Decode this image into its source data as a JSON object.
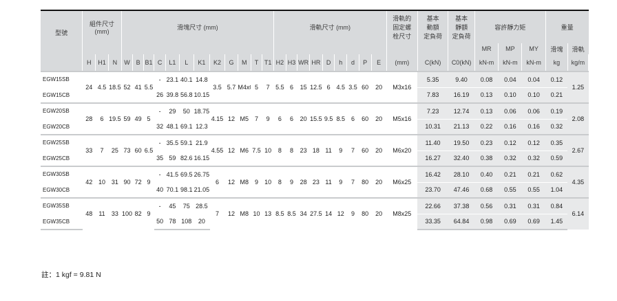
{
  "header": {
    "model": "型號",
    "assembly": "組件尺寸\n(mm)",
    "block": "滑塊尺寸 (mm)",
    "rail": "滑軌尺寸 (mm)",
    "bolt": "滑軌的\n固定螺\n栓尺寸",
    "basic_dynamic": "基本\n動額\n定負荷",
    "basic_static": "基本\n靜額\n定負荷",
    "static_moment": "容許靜力矩",
    "weight": "重量",
    "mr": "MR",
    "mp": "MP",
    "my": "MY",
    "block_w": "滑塊",
    "rail_w": "滑軌",
    "cols": [
      "H",
      "H1",
      "N",
      "W",
      "B",
      "B1",
      "C",
      "L1",
      "L",
      "K1",
      "K2",
      "G",
      "M",
      "T",
      "T1",
      "H2",
      "H3",
      "WR",
      "HR",
      "D",
      "h",
      "d",
      "P",
      "E"
    ],
    "bolt_unit": "(mm)",
    "c_unit": "C(kN)",
    "c0_unit": "C0(kN)",
    "knm1": "kN-m",
    "knm2": "kN-m",
    "knm3": "kN-m",
    "kg": "kg",
    "kgm": "kg/m"
  },
  "groups": [
    {
      "models": [
        "EGW15SB",
        "EGW15CB"
      ],
      "H": "24",
      "H1": "4.5",
      "N": "18.5",
      "W": "52",
      "B": "41",
      "B1": "5.5",
      "rows": [
        {
          "C": "-",
          "L1": "23.1",
          "L": "40.1",
          "K1": "14.8",
          "C_kN": "5.35",
          "C0_kN": "9.40",
          "MR": "0.08",
          "MP": "0.04",
          "MY": "0.04",
          "kg": "0.12"
        },
        {
          "C": "26",
          "L1": "39.8",
          "L": "56.8",
          "K1": "10.15",
          "C_kN": "7.83",
          "C0_kN": "16.19",
          "MR": "0.13",
          "MP": "0.10",
          "MY": "0.10",
          "kg": "0.21"
        }
      ],
      "K2": "3.5",
      "G": "5.7",
      "M": "M4x0.7",
      "T": "5",
      "T1": "7",
      "H2": "5.5",
      "H3": "6",
      "WR": "15",
      "HR": "12.5",
      "D": "6",
      "h": "4.5",
      "d": "3.5",
      "P": "60",
      "E": "20",
      "bolt": "M3x16",
      "rail_kgm": "1.25"
    },
    {
      "models": [
        "EGW20SB",
        "EGW20CB"
      ],
      "H": "28",
      "H1": "6",
      "N": "19.5",
      "W": "59",
      "B": "49",
      "B1": "5",
      "rows": [
        {
          "C": "-",
          "L1": "29",
          "L": "50",
          "K1": "18.75",
          "C_kN": "7.23",
          "C0_kN": "12.74",
          "MR": "0.13",
          "MP": "0.06",
          "MY": "0.06",
          "kg": "0.19"
        },
        {
          "C": "32",
          "L1": "48.1",
          "L": "69.1",
          "K1": "12.3",
          "C_kN": "10.31",
          "C0_kN": "21.13",
          "MR": "0.22",
          "MP": "0.16",
          "MY": "0.16",
          "kg": "0.32"
        }
      ],
      "K2": "4.15",
      "G": "12",
      "M": "M5",
      "T": "7",
      "T1": "9",
      "H2": "6",
      "H3": "6",
      "WR": "20",
      "HR": "15.5",
      "D": "9.5",
      "h": "8.5",
      "d": "6",
      "P": "60",
      "E": "20",
      "bolt": "M5x16",
      "rail_kgm": "2.08"
    },
    {
      "models": [
        "EGW25SB",
        "EGW25CB"
      ],
      "H": "33",
      "H1": "7",
      "N": "25",
      "W": "73",
      "B": "60",
      "B1": "6.5",
      "rows": [
        {
          "C": "-",
          "L1": "35.5",
          "L": "59.1",
          "K1": "21.9",
          "C_kN": "11.40",
          "C0_kN": "19.50",
          "MR": "0.23",
          "MP": "0.12",
          "MY": "0.12",
          "kg": "0.35"
        },
        {
          "C": "35",
          "L1": "59",
          "L": "82.6",
          "K1": "16.15",
          "C_kN": "16.27",
          "C0_kN": "32.40",
          "MR": "0.38",
          "MP": "0.32",
          "MY": "0.32",
          "kg": "0.59"
        }
      ],
      "K2": "4.55",
      "G": "12",
      "M": "M6",
      "T": "7.5",
      "T1": "10",
      "H2": "8",
      "H3": "8",
      "WR": "23",
      "HR": "18",
      "D": "11",
      "h": "9",
      "d": "7",
      "P": "60",
      "E": "20",
      "bolt": "M6x20",
      "rail_kgm": "2.67"
    },
    {
      "models": [
        "EGW30SB",
        "EGW30CB"
      ],
      "H": "42",
      "H1": "10",
      "N": "31",
      "W": "90",
      "B": "72",
      "B1": "9",
      "rows": [
        {
          "C": "-",
          "L1": "41.5",
          "L": "69.5",
          "K1": "26.75",
          "C_kN": "16.42",
          "C0_kN": "28.10",
          "MR": "0.40",
          "MP": "0.21",
          "MY": "0.21",
          "kg": "0.62"
        },
        {
          "C": "40",
          "L1": "70.1",
          "L": "98.1",
          "K1": "21.05",
          "C_kN": "23.70",
          "C0_kN": "47.46",
          "MR": "0.68",
          "MP": "0.55",
          "MY": "0.55",
          "kg": "1.04"
        }
      ],
      "K2": "6",
      "G": "12",
      "M": "M8",
      "T": "9",
      "T1": "10",
      "H2": "8",
      "H3": "9",
      "WR": "28",
      "HR": "23",
      "D": "11",
      "h": "9",
      "d": "7",
      "P": "80",
      "E": "20",
      "bolt": "M6x25",
      "rail_kgm": "4.35"
    },
    {
      "models": [
        "EGW35SB",
        "EGW35CB"
      ],
      "H": "48",
      "H1": "11",
      "N": "33",
      "W": "100",
      "B": "82",
      "B1": "9",
      "rows": [
        {
          "C": "-",
          "L1": "45",
          "L": "75",
          "K1": "28.5",
          "C_kN": "22.66",
          "C0_kN": "37.38",
          "MR": "0.56",
          "MP": "0.31",
          "MY": "0.31",
          "kg": "0.84"
        },
        {
          "C": "50",
          "L1": "78",
          "L": "108",
          "K1": "20",
          "C_kN": "33.35",
          "C0_kN": "64.84",
          "MR": "0.98",
          "MP": "0.69",
          "MY": "0.69",
          "kg": "1.45"
        }
      ],
      "K2": "7",
      "G": "12",
      "M": "M8",
      "T": "10",
      "T1": "13",
      "H2": "8.5",
      "H3": "8.5",
      "WR": "34",
      "HR": "27.5",
      "D": "14",
      "h": "12",
      "d": "9",
      "P": "80",
      "E": "20",
      "bolt": "M8x25",
      "rail_kgm": "6.14"
    }
  ],
  "note": "註：1 kgf = 9.81 N"
}
